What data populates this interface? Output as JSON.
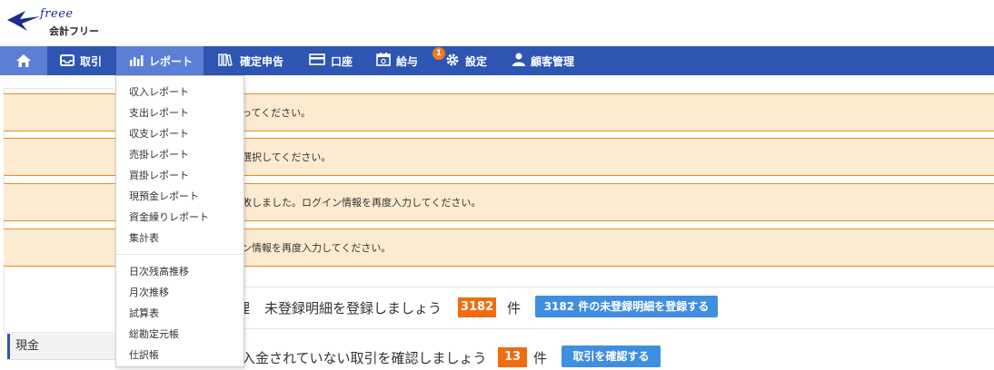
{
  "logo": {
    "script": "freee",
    "label": "会計フリー"
  },
  "nav": {
    "items": [
      {
        "label": "取引"
      },
      {
        "label": "レポート"
      },
      {
        "label": "確定申告"
      },
      {
        "label": "口座"
      },
      {
        "label": "給与"
      },
      {
        "label": "設定"
      },
      {
        "label": "顧客管理"
      }
    ],
    "settings_badge": "1"
  },
  "sidebar": {
    "cash_label": "現金"
  },
  "alerts": [
    "ってください。",
    "選択してください。",
    "敗しました。ログイン情報を再度入力してください。",
    "ン情報を再度入力してください。"
  ],
  "rows": [
    {
      "lead": "理",
      "text": "未登録明細を登録しましょう",
      "count": "3182",
      "unit": "件",
      "button": "3182 件の未登録明細を登録する"
    },
    {
      "lead": "",
      "text": "入金されていない取引を確認しましょう",
      "count": "13",
      "unit": "件",
      "button": "取引を確認する"
    }
  ],
  "report_menu": {
    "group1": [
      "収入レポート",
      "支出レポート",
      "収支レポート",
      "売掛レポート",
      "買掛レポート",
      "現預金レポート",
      "資金繰りレポート",
      "集計表"
    ],
    "group2": [
      "日次残高推移",
      "月次推移",
      "試算表",
      "総勘定元帳",
      "仕訳帳"
    ]
  },
  "colors": {
    "nav_bg": "#2e55b2",
    "alert_bg": "#fcebd0",
    "alert_border": "#ef8a1e",
    "count_bg": "#ef6d10",
    "button_bg": "#3f8ee0"
  }
}
